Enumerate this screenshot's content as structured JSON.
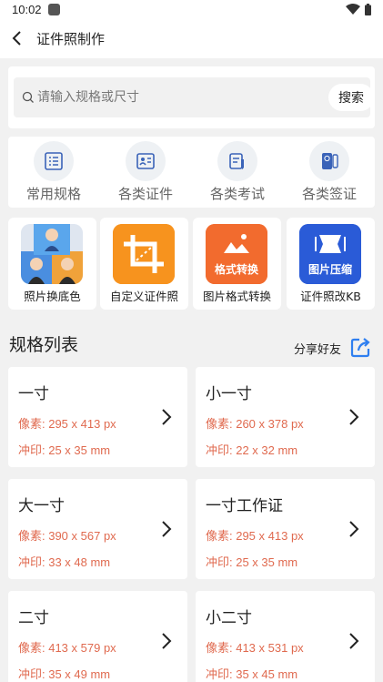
{
  "status": {
    "time": "10:02"
  },
  "header": {
    "title": "证件照制作"
  },
  "search": {
    "placeholder": "请输入规格或尺寸",
    "button": "搜索"
  },
  "categories": [
    {
      "label": "常用规格",
      "icon": "list-icon"
    },
    {
      "label": "各类证件",
      "icon": "id-card-icon"
    },
    {
      "label": "各类考试",
      "icon": "exam-pen-icon"
    },
    {
      "label": "各类签证",
      "icon": "passport-icon"
    }
  ],
  "tools": [
    {
      "label": "照片换底色",
      "icon": "portrait-photos-icon"
    },
    {
      "label": "自定义证件照",
      "icon": "crop-icon"
    },
    {
      "label": "图片格式转换",
      "icon_text": "格式转换",
      "icon": "image-format-icon"
    },
    {
      "label": "证件照改KB",
      "icon_text": "图片压缩",
      "icon": "image-compress-icon"
    }
  ],
  "section": {
    "title": "规格列表",
    "share_label": "分享好友"
  },
  "specs": [
    {
      "name": "一寸",
      "pixels": "像素: 295 x 413 px",
      "print": "冲印: 25 x 35 mm"
    },
    {
      "name": "小一寸",
      "pixels": "像素: 260 x 378 px",
      "print": "冲印: 22 x 32 mm"
    },
    {
      "name": "大一寸",
      "pixels": "像素: 390 x 567 px",
      "print": "冲印: 33 x 48 mm"
    },
    {
      "name": "一寸工作证",
      "pixels": "像素: 295 x 413 px",
      "print": "冲印: 25 x 35 mm"
    },
    {
      "name": "二寸",
      "pixels": "像素: 413 x 579 px",
      "print": "冲印: 35 x 49 mm"
    },
    {
      "name": "小二寸",
      "pixels": "像素: 413 x 531 px",
      "print": "冲印: 35 x 45 mm"
    }
  ],
  "colors": {
    "accent": "#e06a4f",
    "icon_blue": "#3a63b8",
    "share_blue": "#2f7ff0",
    "orange": "#f7931e",
    "compress_blue": "#2a5bd7"
  }
}
